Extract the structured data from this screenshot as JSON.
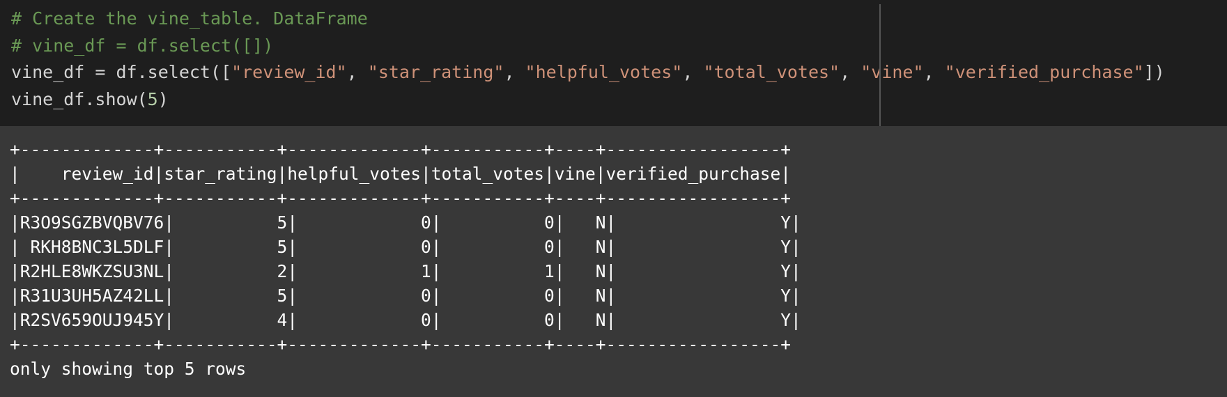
{
  "code_cell": {
    "line1": "# Create the vine_table. DataFrame",
    "line2": "# vine_df = df.select([])",
    "line3": {
      "prefix": "vine_df = df.select([",
      "arg1": "\"review_id\"",
      "arg2": "\"star_rating\"",
      "arg3": "\"helpful_votes\"",
      "arg4": "\"total_votes\"",
      "arg5": "\"vine\"",
      "arg6": "\"verified_purchase\"",
      "sep": ", ",
      "suffix": "])"
    },
    "line4": {
      "prefix": "vine_df.show(",
      "arg": "5",
      "suffix": ")"
    }
  },
  "output": {
    "border": "+-------------+-----------+-------------+-----------+----+-----------------+",
    "header": "|    review_id|star_rating|helpful_votes|total_votes|vine|verified_purchase|",
    "rows": [
      "|R3O9SGZBVQBV76|          5|            0|          0|   N|                Y|",
      "| RKH8BNC3L5DLF|          5|            0|          0|   N|                Y|",
      "|R2HLE8WKZSU3NL|          2|            1|          1|   N|                Y|",
      "|R31U3UH5AZ42LL|          5|            0|          0|   N|                Y|",
      "|R2SV659OUJ945Y|          4|            0|          0|   N|                Y|"
    ],
    "footer": "only showing top 5 rows"
  },
  "colors": {
    "editor_background": "#1e1e1e",
    "output_background": "#383838",
    "comment": "#6a9955",
    "string": "#ce9178",
    "text": "#d4d4d4"
  }
}
